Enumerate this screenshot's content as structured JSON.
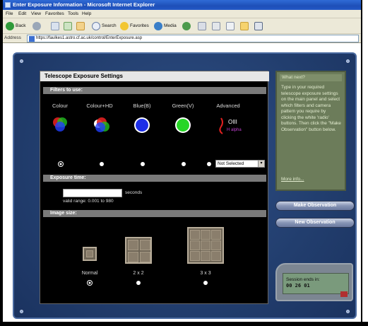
{
  "window": {
    "title": "Enter Exposure Information - Microsoft Internet Explorer"
  },
  "menu": [
    "File",
    "Edit",
    "View",
    "Favorites",
    "Tools",
    "Help"
  ],
  "toolbar": {
    "back": "Back",
    "search": "Search",
    "favorites": "Favorites",
    "media": "Media"
  },
  "address": {
    "label": "Address",
    "url": "https://faulkes1.astro.cf.ac.uk/control/EnterExposure.asp"
  },
  "main": {
    "title": "Telescope Exposure Settings",
    "filters": {
      "header": "Filters to use:",
      "options": [
        {
          "label": "Colour",
          "selected": true
        },
        {
          "label": "Colour+HD",
          "selected": false
        },
        {
          "label": "Blue(B)",
          "selected": false
        },
        {
          "label": "Green(V)",
          "selected": false
        },
        {
          "label": "Advanced",
          "selected": false
        }
      ],
      "advanced_icon_text": "OIII",
      "advanced_icon_subtext": "H alpha",
      "select_value": "Not Selected"
    },
    "exposure": {
      "header": "Exposure time:",
      "seconds_value": "",
      "units": "seconds",
      "range": "valid range: 0.001 to 980"
    },
    "image_size": {
      "header": "Image size:",
      "options": [
        {
          "label": "Normal",
          "selected": true
        },
        {
          "label": "2 x 2",
          "selected": false
        },
        {
          "label": "3 x 3",
          "selected": false
        }
      ]
    }
  },
  "side": {
    "title": "What next?",
    "text": "Type in your required telescope exposure settings on the main panel and select which filters and camera pattern you require by clicking the white 'radio' buttons. Then click the \"Make Observation\" button below.",
    "more_info": "More info..."
  },
  "buttons": {
    "make_observation": "Make Observation",
    "new_observation": "New Observation"
  },
  "timer": {
    "label": "Session ends in:",
    "value": "00 26 01"
  },
  "colors": {
    "console": "#223e6e",
    "side_panel": "#6c7c5a",
    "section_header": "#7a7a7a"
  }
}
